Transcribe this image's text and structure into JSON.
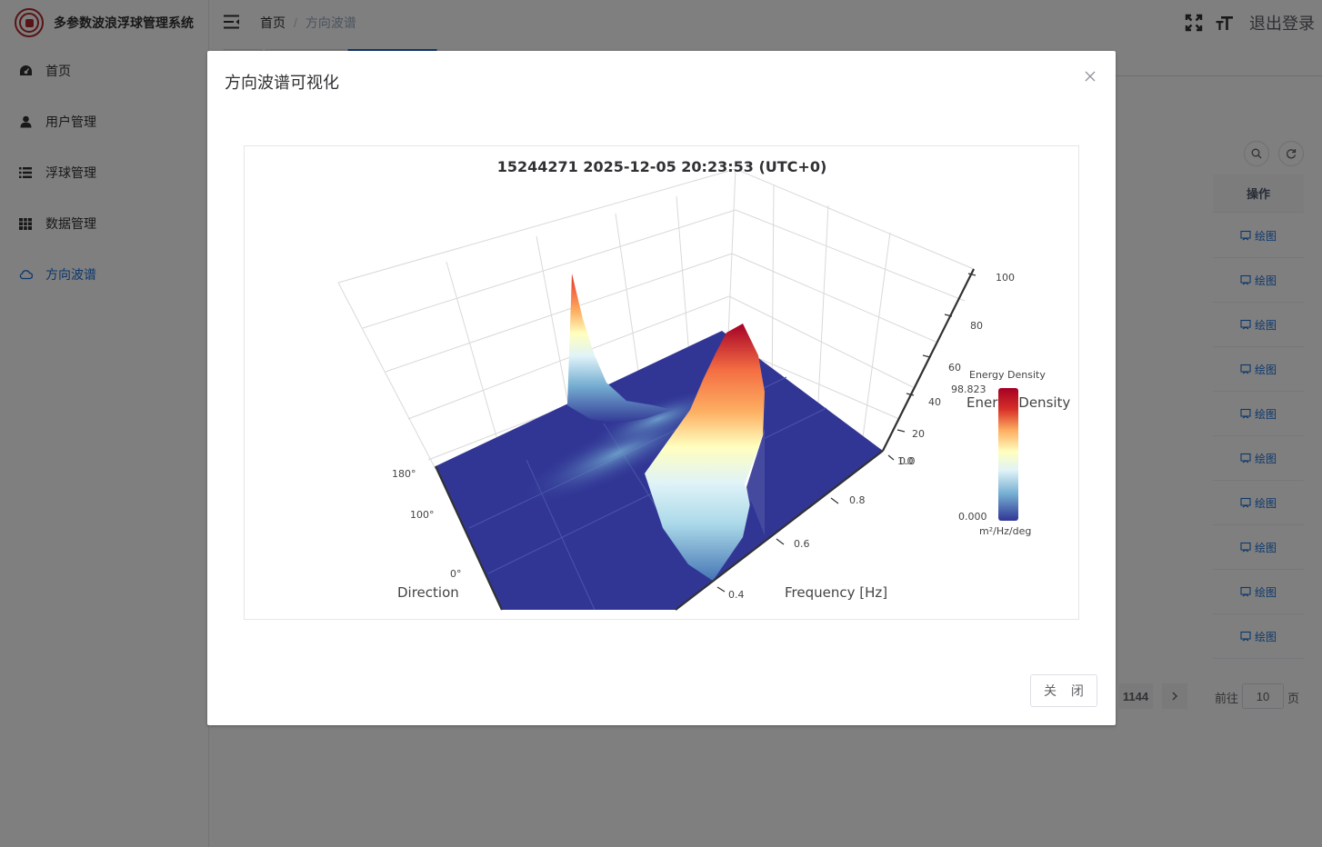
{
  "app": {
    "title": "多参数波浪浮球管理系统"
  },
  "sidebar": {
    "items": [
      {
        "label": "首页",
        "icon": "dashboard-icon"
      },
      {
        "label": "用户管理",
        "icon": "user-icon"
      },
      {
        "label": "浮球管理",
        "icon": "list-icon"
      },
      {
        "label": "数据管理",
        "icon": "table-icon"
      },
      {
        "label": "方向波谱",
        "icon": "cloud-icon"
      }
    ],
    "active_index": 4
  },
  "header": {
    "breadcrumb": {
      "home": "首页",
      "separator": "/",
      "current": "方向波谱"
    },
    "logout_label": "退出登录"
  },
  "table": {
    "action_header": "操作",
    "row_action_label": "绘图",
    "row_count": 10
  },
  "pagination": {
    "current_page": "1144",
    "goto_label": "前往",
    "goto_value": "10",
    "page_suffix": "页"
  },
  "dialog": {
    "title": "方向波谱可视化",
    "close_button_label": "关 闭"
  },
  "chart_data": {
    "type": "surface3d",
    "title": "15244271 2025-12-05 20:23:53 (UTC+0)",
    "x_axis": {
      "label": "Frequency [Hz]",
      "ticks": [
        "0.4",
        "0.6",
        "0.8",
        "1.0"
      ]
    },
    "y_axis": {
      "label": "Direction",
      "ticks": [
        "0°",
        "100°",
        "180°"
      ]
    },
    "z_axis": {
      "ticks": [
        "0.0",
        "20",
        "40",
        "60",
        "80",
        "100"
      ]
    },
    "colorbar": {
      "title": "Energy Density",
      "max": "98.823",
      "min": "0.000",
      "unit": "m²/Hz/deg",
      "colorscale": [
        "#313695",
        "#4575b4",
        "#74add1",
        "#abd9e9",
        "#e0f3f8",
        "#ffffbf",
        "#fee090",
        "#fdae61",
        "#f46d43",
        "#d73027",
        "#a50026"
      ]
    },
    "scene_overlay_label": "Energy Density",
    "peaks": [
      {
        "frequency_hz": 0.55,
        "direction_deg": 180,
        "value": 62
      },
      {
        "frequency_hz": 0.7,
        "direction_deg": 100,
        "value": 98.823
      }
    ]
  },
  "colors": {
    "accent": "#1a6fd8",
    "brand_red": "#b0282c",
    "surface_base": "#313695"
  }
}
